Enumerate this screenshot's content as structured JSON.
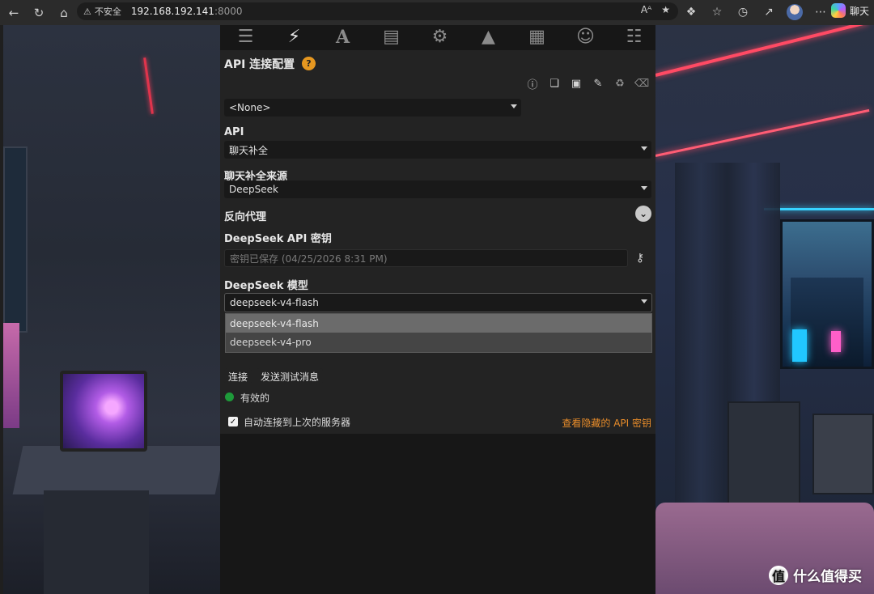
{
  "browser": {
    "security_label": "不安全",
    "url_host": "192.168.192.141",
    "url_port": ":8000",
    "read_aloud_label": "Aᴬ",
    "copilot_label": "聊天"
  },
  "api_config": {
    "title": "API 连接配置",
    "help_label": "?",
    "profile_value": "<None>"
  },
  "api": {
    "label": "API",
    "value": "聊天补全"
  },
  "source": {
    "label": "聊天补全来源",
    "value": "DeepSeek"
  },
  "proxy": {
    "label": "反向代理"
  },
  "api_key": {
    "label": "DeepSeek API 密钥",
    "placeholder": "密钥已保存 (04/25/2026 8:31 PM)"
  },
  "model": {
    "label": "DeepSeek 模型",
    "value": "deepseek-v4-flash",
    "options": [
      "deepseek-v4-flash",
      "deepseek-v4-pro"
    ]
  },
  "actions": {
    "connect_label": "连接",
    "test_label": "发送测试消息"
  },
  "status": {
    "text": "有效的",
    "color": "#1e9a3a"
  },
  "auto_connect": {
    "label": "自动连接到上次的服务器",
    "checked": true
  },
  "reveal_keys_label": "查看隐藏的 API 密钥",
  "watermark": {
    "text": "什么值得买",
    "logo_char": "值"
  },
  "colors": {
    "accent_orange": "#e88c2a",
    "help_badge": "#e69720"
  }
}
